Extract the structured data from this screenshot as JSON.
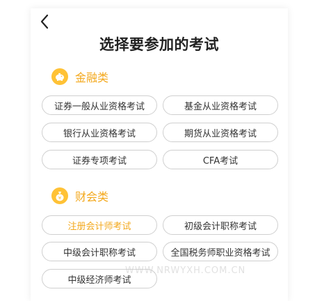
{
  "page": {
    "title": "选择要参加的考试"
  },
  "sections": [
    {
      "label": "金融类",
      "icon": "piggy-bank-icon",
      "items": [
        {
          "label": "证券一般从业资格考试",
          "active": false
        },
        {
          "label": "基金从业资格考试",
          "active": false
        },
        {
          "label": "银行从业资格考试",
          "active": false
        },
        {
          "label": "期货从业资格考试",
          "active": false
        },
        {
          "label": "证券专项考试",
          "active": false
        },
        {
          "label": "CFA考试",
          "active": false
        }
      ]
    },
    {
      "label": "财会类",
      "icon": "money-bag-icon",
      "items": [
        {
          "label": "注册会计师考试",
          "active": true
        },
        {
          "label": "初级会计职称考试",
          "active": false
        },
        {
          "label": "中级会计职称考试",
          "active": false
        },
        {
          "label": "全国税务师职业资格考试",
          "active": false
        },
        {
          "label": "中级经济师考试",
          "active": false
        }
      ]
    }
  ],
  "colors": {
    "accent": "#f3a81c",
    "icon_bg": "#ffc236",
    "pill_border": "#cfcfcf"
  },
  "watermark": "WWW.NRWYXH.COM.CN"
}
